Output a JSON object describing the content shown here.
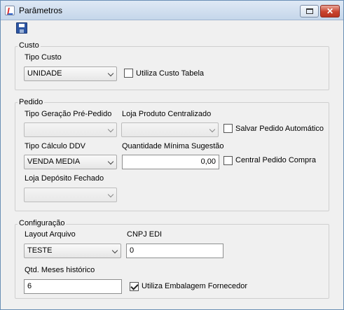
{
  "window": {
    "title": "Parâmetros"
  },
  "custo": {
    "legend": "Custo",
    "tipo_custo_label": "Tipo Custo",
    "tipo_custo_value": "UNIDADE",
    "utiliza_custo_tabela_label": "Utiliza Custo Tabela",
    "utiliza_custo_tabela_checked": false
  },
  "pedido": {
    "legend": "Pedido",
    "tipo_geracao_label": "Tipo Geração Pré-Pedido",
    "tipo_geracao_value": "",
    "loja_produto_label": "Loja Produto Centralizado",
    "loja_produto_value": "",
    "salvar_pedido_label": "Salvar Pedido Automático",
    "salvar_pedido_checked": false,
    "tipo_calculo_label": "Tipo Cálculo DDV",
    "tipo_calculo_value": "VENDA MEDIA",
    "qtd_minima_label": "Quantidade Mínima Sugestão",
    "qtd_minima_value": "0,00",
    "central_pedido_label": "Central Pedido Compra",
    "central_pedido_checked": false,
    "loja_deposito_label": "Loja Depósito Fechado",
    "loja_deposito_value": ""
  },
  "configuracao": {
    "legend": "Configuração",
    "layout_arquivo_label": "Layout Arquivo",
    "layout_arquivo_value": "TESTE",
    "cnpj_edi_label": "CNPJ EDI",
    "cnpj_edi_value": "0",
    "qtd_meses_label": "Qtd. Meses histórico",
    "qtd_meses_value": "6",
    "utiliza_embalagem_label": "Utiliza Embalagem Fornecedor",
    "utiliza_embalagem_checked": true
  }
}
